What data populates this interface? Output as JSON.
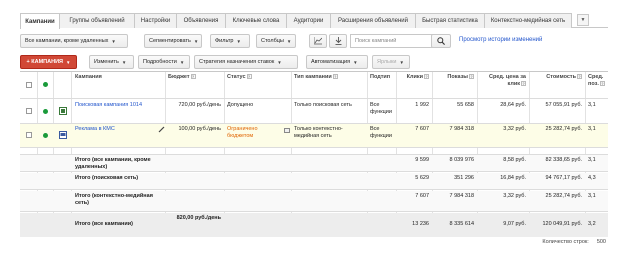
{
  "tabs": [
    "Кампании",
    "Группы объявлений",
    "Настройки",
    "Объявления",
    "Ключевые слова",
    "Аудитории",
    "Расширения объявлений",
    "Быстрая статистика",
    "Контекстно-медийная сеть"
  ],
  "filters": {
    "all_campaigns": "Все кампании, кроме удаленных",
    "segment": "Сегментировать",
    "filter": "Фильтр",
    "columns": "Столбцы",
    "search_placeholder": "Поиск кампаний",
    "history_link": "Просмотр истории изменений"
  },
  "actions": {
    "add_campaign": "+ КАМПАНИЯ",
    "edit": "Изменить",
    "details": "Подробности",
    "bid_strategy": "Стратегия назначения ставок",
    "automation": "Автоматизация",
    "labels": "Ярлыки"
  },
  "columns": {
    "campaign": "Кампания",
    "budget": "Бюджет",
    "status": "Статус",
    "type": "Тип кампании",
    "subtype": "Подтип",
    "clicks": "Клики",
    "impressions": "Показы",
    "avg_cpc": "Сред. цена за клик",
    "cost": "Стоимость",
    "avg_pos": "Сред. поз."
  },
  "rows": [
    {
      "name": "Поисковая кампания 1014",
      "budget": "720,00 руб./день",
      "status": "Допущено",
      "type": "Только поисковая сеть",
      "subtype": "Все функции",
      "clicks": "1 992",
      "impressions": "55 658",
      "cpc": "28,64 руб.",
      "cost": "57 055,91 руб.",
      "pos": "3,1"
    },
    {
      "name": "Реклама в КМС",
      "budget": "100,00 руб./день",
      "status": "Ограничено бюджетом",
      "type": "Только контекстно-медийная сеть",
      "subtype": "Все функции",
      "clicks": "7 607",
      "impressions": "7 984 318",
      "cpc": "3,32 руб.",
      "cost": "25 282,74 руб.",
      "pos": "3,1"
    }
  ],
  "totals": [
    {
      "label": "Итого (все кампании, кроме удаленных)",
      "clicks": "9 599",
      "impressions": "8 039 976",
      "cpc": "8,58 руб.",
      "cost": "82 338,65 руб.",
      "pos": "3,1"
    },
    {
      "label": "Итого (поисковая сеть)",
      "clicks": "5 629",
      "impressions": "351 296",
      "cpc": "16,84 руб.",
      "cost": "94 767,17 руб.",
      "pos": "4,3"
    },
    {
      "label": "Итого (контекстно-медийная сеть)",
      "clicks": "7 607",
      "impressions": "7 984 318",
      "cpc": "3,32 руб.",
      "cost": "25 282,74 руб.",
      "pos": "3,1"
    }
  ],
  "grand_total": {
    "label": "Итого (все кампании)",
    "budget": "820,00 руб./день",
    "clicks": "13 236",
    "impressions": "8 335 614",
    "cpc": "9,07 руб.",
    "cost": "120 049,91 руб.",
    "pos": "3,2"
  },
  "footer": {
    "rows_label": "Количество строк:",
    "rows_value": "500"
  },
  "colors": {
    "accent_red": "#d14836",
    "link_blue": "#2255cc",
    "status_green": "#1a9a3a",
    "limited_orange": "#e06400"
  }
}
